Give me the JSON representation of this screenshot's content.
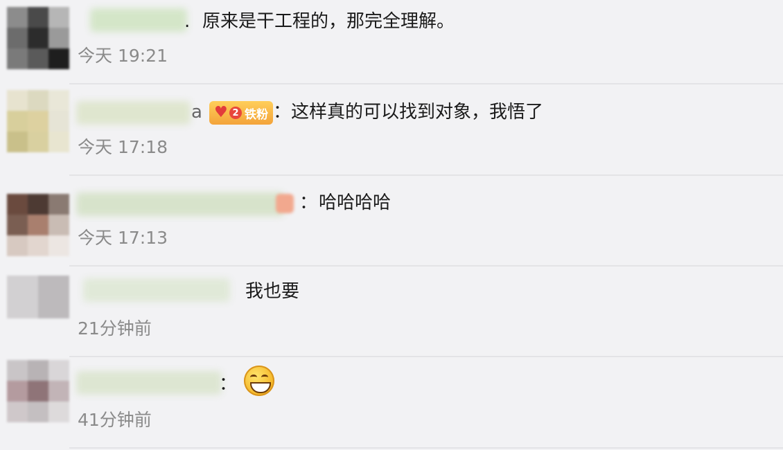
{
  "comments": [
    {
      "prefix": ".",
      "message": "原来是干工程的，那完全理解。",
      "time": "今天 19:21"
    },
    {
      "prefix": "a",
      "badge": "铁粉",
      "badge_level": "2",
      "separator": "：",
      "message": "这样真的可以找到对象，我悟了",
      "time": "今天 17:18"
    },
    {
      "separator": "：",
      "message": "哈哈哈哈",
      "time": "今天 17:13"
    },
    {
      "separator": "",
      "message": "我也要",
      "time": "21分钟前"
    },
    {
      "separator": "：",
      "message": "",
      "emoji": "grinning-face-emoji",
      "time": "41分钟前"
    }
  ],
  "icons": {
    "badge_heart": "heart-icon"
  },
  "colors": {
    "background": "#f2f2f4",
    "badge_gold": "#f3a33a",
    "badge_red": "#e8473b",
    "time_gray": "#8a8a8a"
  }
}
